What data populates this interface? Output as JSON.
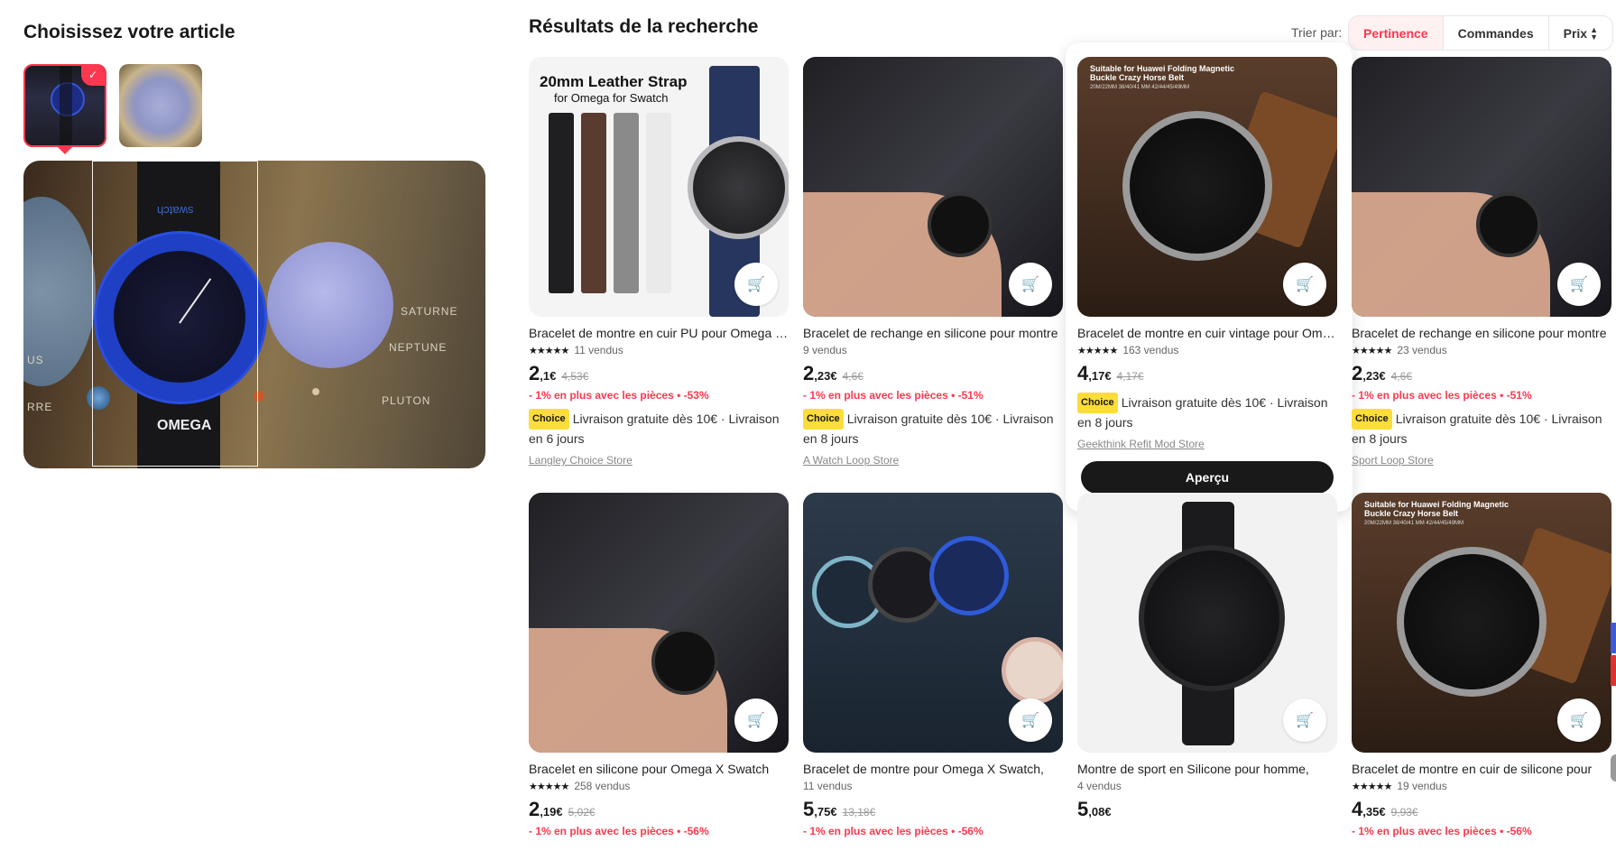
{
  "left": {
    "title": "Choisissez votre article",
    "planet_labels": [
      "SATURNE",
      "NEPTUNE",
      "PLUTON",
      "US",
      "RRE"
    ],
    "watch_brand": "OMEGA",
    "strap_text": "swatch"
  },
  "results": {
    "title": "Résultats de la recherche",
    "sort_label": "Trier par:",
    "sort_options": [
      "Pertinence",
      "Commandes",
      "Prix"
    ],
    "active_sort": "Pertinence"
  },
  "products": [
    {
      "title": "Bracelet de montre en cuir PU pour Omega Swatch",
      "rating": "★★★★★",
      "sold": "11 vendus",
      "price_int": "2",
      "price_dec": ",1€",
      "old_price": "4,53€",
      "promo": "- 1% en plus avec les pièces • -53%",
      "badge": "Choice",
      "shipping": "Livraison gratuite dès 10€ · Livraison en 6 jours",
      "store": "Langley Choice Store",
      "img_caption1": "20mm Leather Strap",
      "img_caption2": "for Omega for Swatch"
    },
    {
      "title": "Bracelet de rechange en silicone pour montre",
      "rating": "",
      "sold": "9 vendus",
      "price_int": "2",
      "price_dec": ",23€",
      "old_price": "4,6€",
      "promo": "- 1% en plus avec les pièces • -51%",
      "badge": "Choice",
      "shipping": "Livraison gratuite dès 10€ · Livraison en 8 jours",
      "store": "A Watch Loop Store"
    },
    {
      "title": "Bracelet de montre en cuir vintage pour Omega",
      "rating": "★★★★★",
      "sold": "163 vendus",
      "price_int": "4",
      "price_dec": ",17€",
      "old_price": "4,17€",
      "promo": "",
      "badge": "Choice",
      "shipping": "Livraison gratuite dès 10€ · Livraison en 8 jours",
      "store": "Geekthink Refit Mod Store",
      "button": "Aperçu",
      "img_caption1": "Suitable for Huawei Folding Magnetic",
      "img_caption2": "Buckle Crazy Horse Belt",
      "img_caption3": "20M/22MM 38/40/41 MM 42/44/45/49MM"
    },
    {
      "title": "Bracelet de rechange en silicone pour montre",
      "rating": "★★★★★",
      "sold": "23 vendus",
      "price_int": "2",
      "price_dec": ",23€",
      "old_price": "4,6€",
      "promo": "- 1% en plus avec les pièces • -51%",
      "badge": "Choice",
      "shipping": "Livraison gratuite dès 10€ · Livraison en 8 jours",
      "store": "Sport Loop Store"
    },
    {
      "title": "Bracelet en silicone pour Omega X Swatch",
      "rating": "★★★★★",
      "sold": "258 vendus",
      "price_int": "2",
      "price_dec": ",19€",
      "old_price": "5,02€",
      "promo": "- 1% en plus avec les pièces • -56%"
    },
    {
      "title": "Bracelet de montre pour Omega X Swatch,",
      "rating": "",
      "sold": "11 vendus",
      "price_int": "5",
      "price_dec": ",75€",
      "old_price": "13,18€",
      "promo": "- 1% en plus avec les pièces • -56%"
    },
    {
      "title": "Montre de sport en Silicone pour homme,",
      "rating": "",
      "sold": "4 vendus",
      "price_int": "5",
      "price_dec": ",08€",
      "old_price": "",
      "promo": ""
    },
    {
      "title": "Bracelet de montre en cuir de silicone pour",
      "rating": "★★★★★",
      "sold": "19 vendus",
      "price_int": "4",
      "price_dec": ",35€",
      "old_price": "9,93€",
      "promo": "- 1% en plus avec les pièces • -56%",
      "img_caption1": "Suitable for Huawei Folding Magnetic",
      "img_caption2": "Buckle Crazy Horse Belt",
      "img_caption3": "20M/22MM 38/40/41 MM 42/44/45/49MM"
    }
  ],
  "colors": {
    "accent": "#fd384f",
    "choice_badge": "#fcdd3b",
    "dark": "#191919"
  },
  "icons": {
    "cart": "cart-plus-icon",
    "sort": "sort-updown-icon",
    "check": "check-icon"
  }
}
